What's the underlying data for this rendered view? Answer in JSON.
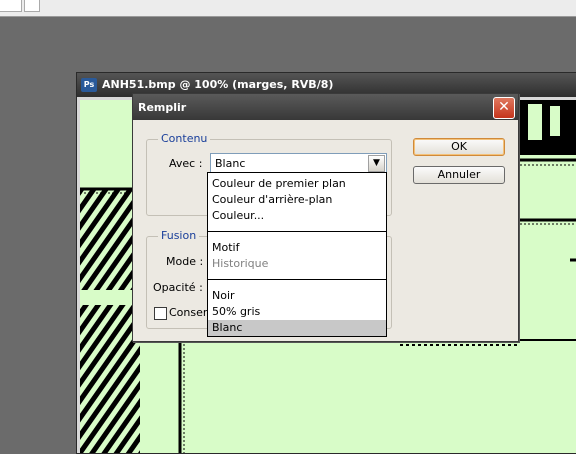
{
  "document": {
    "title": "ANH51.bmp @ 100% (marges, RVB/8)",
    "app_icon": "Ps"
  },
  "dialog": {
    "title": "Remplir",
    "close_glyph": "✕",
    "contenu": {
      "legend": "Contenu",
      "avec_label": "Avec :",
      "avec_value": "Blanc",
      "arrow_glyph": "▼"
    },
    "fusion": {
      "legend": "Fusion",
      "mode_label": "Mode :",
      "opacite_label": "Opacité :",
      "conserver_label": "Conser"
    },
    "buttons": {
      "ok": "OK",
      "annuler": "Annuler"
    }
  },
  "dropdown": {
    "items": [
      "Couleur de premier plan",
      "Couleur d'arrière-plan",
      "Couleur...",
      "Motif",
      "Historique",
      "Noir",
      "50% gris",
      "Blanc"
    ],
    "selected": "Blanc"
  }
}
